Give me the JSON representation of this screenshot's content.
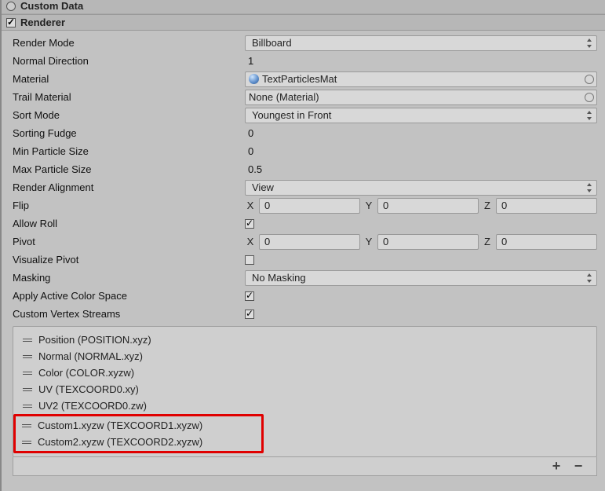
{
  "modules": {
    "customData": {
      "title": "Custom Data",
      "enabled": false
    },
    "renderer": {
      "title": "Renderer",
      "enabled": true
    }
  },
  "props": {
    "renderMode": {
      "label": "Render Mode",
      "value": "Billboard"
    },
    "normalDirection": {
      "label": "Normal Direction",
      "value": "1"
    },
    "material": {
      "label": "Material",
      "value": "TextParticlesMat"
    },
    "trailMaterial": {
      "label": "Trail Material",
      "value": "None (Material)"
    },
    "sortMode": {
      "label": "Sort Mode",
      "value": "Youngest in Front"
    },
    "sortingFudge": {
      "label": "Sorting Fudge",
      "value": "0"
    },
    "minParticleSize": {
      "label": "Min Particle Size",
      "value": "0"
    },
    "maxParticleSize": {
      "label": "Max Particle Size",
      "value": "0.5"
    },
    "renderAlignment": {
      "label": "Render Alignment",
      "value": "View"
    },
    "flip": {
      "label": "Flip",
      "x": "0",
      "y": "0",
      "z": "0"
    },
    "allowRoll": {
      "label": "Allow Roll",
      "checked": true
    },
    "pivot": {
      "label": "Pivot",
      "x": "0",
      "y": "0",
      "z": "0"
    },
    "visualizePivot": {
      "label": "Visualize Pivot",
      "checked": false
    },
    "masking": {
      "label": "Masking",
      "value": "No Masking"
    },
    "applyActiveColorSpace": {
      "label": "Apply Active Color Space",
      "checked": true
    },
    "customVertexStreams": {
      "label": "Custom Vertex Streams",
      "checked": true
    }
  },
  "streams": [
    "Position (POSITION.xyz)",
    "Normal (NORMAL.xyz)",
    "Color (COLOR.xyzw)",
    "UV (TEXCOORD0.xy)",
    "UV2 (TEXCOORD0.zw)",
    "Custom1.xyzw (TEXCOORD1.xyzw)",
    "Custom2.xyzw (TEXCOORD2.xyzw)"
  ],
  "axes": {
    "x": "X",
    "y": "Y",
    "z": "Z"
  },
  "footer": {
    "add": "+",
    "remove": "−"
  }
}
